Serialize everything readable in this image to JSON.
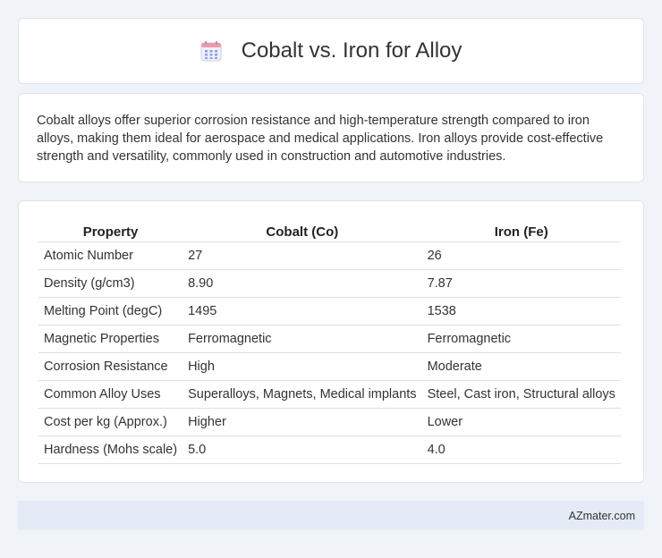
{
  "header": {
    "title": "Cobalt vs. Iron for Alloy",
    "icon": "calendar-icon"
  },
  "summary": {
    "text": "Cobalt alloys offer superior corrosion resistance and high-temperature strength compared to iron alloys, making them ideal for aerospace and medical applications. Iron alloys provide cost-effective strength and versatility, commonly used in construction and automotive industries."
  },
  "table": {
    "headers": [
      "Property",
      "Cobalt (Co)",
      "Iron (Fe)"
    ],
    "rows": [
      [
        "Atomic Number",
        "27",
        "26"
      ],
      [
        "Density (g/cm3)",
        "8.90",
        "7.87"
      ],
      [
        "Melting Point (degC)",
        "1495",
        "1538"
      ],
      [
        "Magnetic Properties",
        "Ferromagnetic",
        "Ferromagnetic"
      ],
      [
        "Corrosion Resistance",
        "High",
        "Moderate"
      ],
      [
        "Common Alloy Uses",
        "Superalloys, Magnets, Medical implants",
        "Steel, Cast iron, Structural alloys"
      ],
      [
        "Cost per kg (Approx.)",
        "Higher",
        "Lower"
      ],
      [
        "Hardness (Mohs scale)",
        "5.0",
        "4.0"
      ]
    ]
  },
  "footer": {
    "text": "AZmater.com"
  },
  "colors": {
    "background": "#f0f3f8",
    "card": "#ffffff",
    "footer": "#e4ebf6",
    "icon_accent": "#7b8ee8"
  }
}
